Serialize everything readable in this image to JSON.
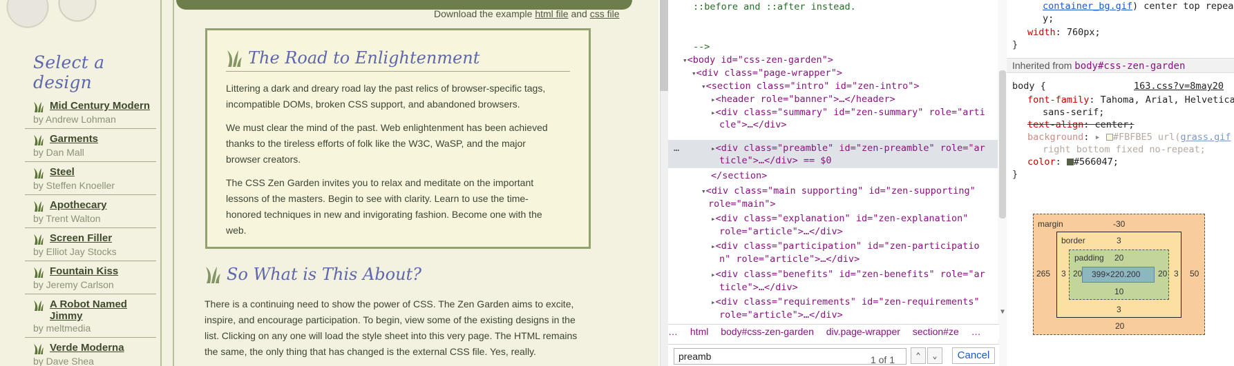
{
  "site": {
    "download_text": "Download the example",
    "html_link": "html file",
    "and_text": "and",
    "css_link": "css file",
    "select_title": "Select a design",
    "designs": [
      {
        "name": "Mid Century Modern",
        "author": "by Andrew Lohman"
      },
      {
        "name": "Garments",
        "author": "by Dan Mall"
      },
      {
        "name": "Steel",
        "author": "by Steffen Knoeller"
      },
      {
        "name": "Apothecary",
        "author": "by Trent Walton"
      },
      {
        "name": "Screen Filler",
        "author": "by Elliot Jay Stocks"
      },
      {
        "name": "Fountain Kiss",
        "author": "by Jeremy Carlson"
      },
      {
        "name": "A Robot Named Jimmy",
        "author": "by meltmedia"
      },
      {
        "name": "Verde Moderna",
        "author": "by Dave Shea"
      }
    ],
    "road_title": "The Road to Enlightenment",
    "road_paragraphs": [
      "Littering a dark and dreary road lay the past relics of browser-specific tags, incompatible DOMs, broken CSS support, and abandoned browsers.",
      "We must clear the mind of the past. Web enlightenment has been achieved thanks to the tireless efforts of folk like the W3C, WaSP, and the major browser creators.",
      "The CSS Zen Garden invites you to relax and meditate on the important lessons of the masters. Begin to see with clarity. Learn to use the time-honored techniques in new and invigorating fashion. Become one with the web."
    ],
    "about_title": "So What is This About?",
    "about_paragraph": "There is a continuing need to show the power of CSS. The Zen Garden aims to excite, inspire, and encourage participation. To begin, view some of the existing designs in the list. Clicking on any one will load the style sheet into this very page. The HTML remains the same, the only thing that has changed is the external CSS file. Yes, really."
  },
  "devtools": {
    "dom_lines": [
      "::before and ::after instead.",
      "",
      "-->",
      "<body id=\"css-zen-garden\">",
      "<div class=\"page-wrapper\">",
      "<section class=\"intro\" id=\"zen-intro\">",
      "<header role=\"banner\">…</header>",
      "<div class=\"summary\" id=\"zen-summary\" role=\"arti",
      "cle\">…</div>",
      "<div class=\"preamble\" id=\"zen-preamble\" role=\"ar",
      "ticle\">…</div> == $0",
      "</section>",
      "<div class=\"main supporting\" id=\"zen-supporting\"",
      "role=\"main\">",
      "<div class=\"explanation\" id=\"zen-explanation\"",
      "role=\"article\">…</div>",
      "<div class=\"participation\" id=\"zen-participatio",
      "n\" role=\"article\">…</div>",
      "<div class=\"benefits\" id=\"zen-benefits\" role=\"ar",
      "ticle\">…</div>",
      "<div class=\"requirements\" id=\"zen-requirements\"",
      "role=\"article\">…</div>"
    ],
    "breadcrumbs": [
      "…",
      "html",
      "body#css-zen-garden",
      "div.page-wrapper",
      "section#ze",
      "…"
    ],
    "search_value": "preamb",
    "search_count": "1 of 1",
    "cancel_label": "Cancel",
    "styles": {
      "top_link": "container_bg.gif",
      "top_rest": ") center top repeat-",
      "top_rest2": "y;",
      "width_prop": "width",
      "width_val": "760px;",
      "inherited_label": "Inherited from",
      "inherited_from": "body#css-zen-garden",
      "body_selector": "body {",
      "source_link": "163.css?v=8may20",
      "font_prop": "font-family",
      "font_val": "Tahoma, Arial, Helvetica,",
      "font_val2": "sans-serif;",
      "text_prop": "text-align",
      "text_val": "center;",
      "bg_prop": "background",
      "bg_val": "#FBFBE5 url(",
      "bg_link": "grass.gif",
      "bg_val2": "right bottom fixed no-repeat;",
      "color_prop": "color",
      "color_val": "#566047;",
      "close_brace": "}"
    },
    "box_model": {
      "margin_label": "margin",
      "margin_top": "-30",
      "margin_left": "265",
      "margin_right": "50",
      "margin_bottom": "20",
      "border_label": "border",
      "border_top": "3",
      "border_left": "3",
      "border_right": "3",
      "border_bottom": "3",
      "padding_label": "padding",
      "padding_top": "20",
      "padding_left": "20",
      "padding_right": "20",
      "padding_bottom": "10",
      "content_size": "399×220.200"
    }
  }
}
